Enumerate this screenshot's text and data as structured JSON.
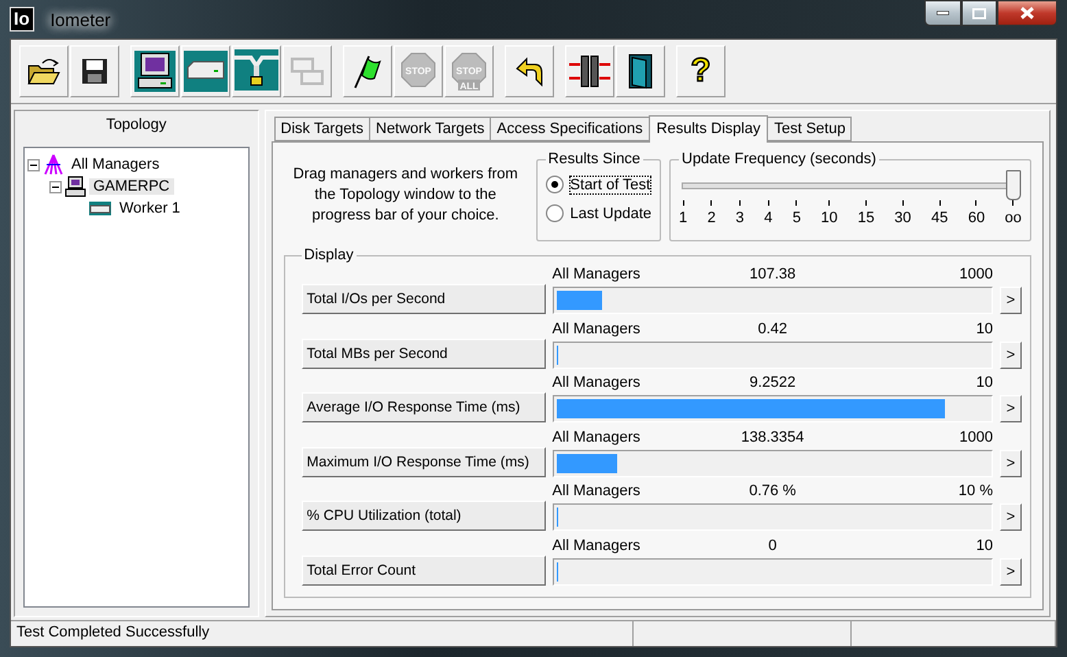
{
  "window": {
    "icon_text": "Io",
    "title": "Iometer"
  },
  "toolbar": [
    [
      {
        "kind": "open",
        "disabled": false
      },
      {
        "kind": "save",
        "disabled": false
      }
    ],
    [
      {
        "kind": "manager",
        "disabled": false
      },
      {
        "kind": "worker",
        "disabled": false
      },
      {
        "kind": "network",
        "disabled": false
      },
      {
        "kind": "copy",
        "disabled": true
      }
    ],
    [
      {
        "kind": "start",
        "disabled": false
      },
      {
        "kind": "stop",
        "disabled": true,
        "label": "STOP"
      },
      {
        "kind": "stopall",
        "disabled": true,
        "label": "STOP",
        "sublabel": "ALL"
      }
    ],
    [
      {
        "kind": "reset",
        "disabled": false
      }
    ],
    [
      {
        "kind": "workers",
        "disabled": false
      },
      {
        "kind": "exit",
        "disabled": false
      }
    ],
    [
      {
        "kind": "help",
        "disabled": false,
        "label": "?"
      }
    ]
  ],
  "topology": {
    "title": "Topology",
    "tree": [
      {
        "label": "All Managers",
        "kind": "all",
        "expanded": true,
        "selected": false,
        "children": [
          {
            "label": "GAMERPC",
            "kind": "manager",
            "expanded": true,
            "selected": true,
            "children": [
              {
                "label": "Worker 1",
                "kind": "worker",
                "selected": false
              }
            ]
          }
        ]
      }
    ]
  },
  "tabs": [
    {
      "label": "Disk Targets",
      "selected": false
    },
    {
      "label": "Network Targets",
      "selected": false
    },
    {
      "label": "Access Specifications",
      "selected": false
    },
    {
      "label": "Results Display",
      "selected": true
    },
    {
      "label": "Test Setup",
      "selected": false
    }
  ],
  "hint": "Drag managers and workers from the Topology window to the progress bar of your choice.",
  "results_since": {
    "title": "Results Since",
    "options": [
      {
        "label": "Start of Test",
        "selected": true
      },
      {
        "label": "Last Update",
        "selected": false
      }
    ]
  },
  "update_frequency": {
    "title": "Update Frequency (seconds)",
    "level": 1,
    "ticks": [
      "1",
      "2",
      "3",
      "4",
      "5",
      "10",
      "15",
      "30",
      "45",
      "60",
      "oo"
    ]
  },
  "display": {
    "title": "Display",
    "rows": [
      {
        "metric": "Total I/Os per Second",
        "source": "All Managers",
        "value": "107.38",
        "max": "1000",
        "level": 0.107
      },
      {
        "metric": "Total MBs per Second",
        "source": "All Managers",
        "value": "0.42",
        "max": "10",
        "level": 0
      },
      {
        "metric": "Average I/O Response Time (ms)",
        "source": "All Managers",
        "value": "9.2522",
        "max": "10",
        "level": 0.9
      },
      {
        "metric": "Maximum I/O Response Time (ms)",
        "source": "All Managers",
        "value": "138.3354",
        "max": "1000",
        "level": 0.14
      },
      {
        "metric": "% CPU Utilization (total)",
        "source": "All Managers",
        "value": "0.76 %",
        "max": "10 %",
        "level": 0
      },
      {
        "metric": "Total Error Count",
        "source": "All Managers",
        "value": "0",
        "max": "10",
        "level": 0
      }
    ],
    "more_label": ">"
  },
  "status_bar": {
    "text": "Test Completed Successfully"
  }
}
